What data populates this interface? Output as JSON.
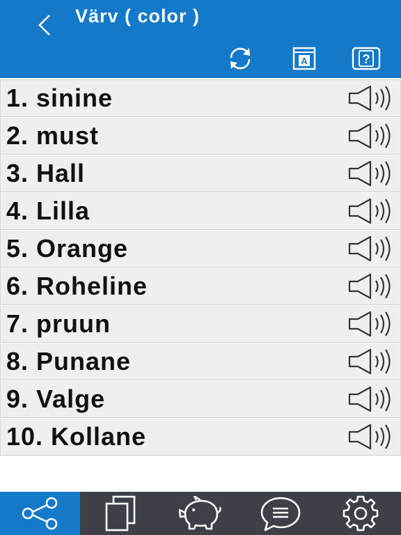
{
  "header": {
    "title": "Värv ( color )",
    "back_icon": "chevron-left-icon",
    "actions": [
      {
        "name": "refresh-icon"
      },
      {
        "name": "dictionary-icon",
        "glyph": "A"
      },
      {
        "name": "help-icon",
        "glyph": "?"
      }
    ]
  },
  "words": [
    {
      "label": "1. sinine"
    },
    {
      "label": "2. must"
    },
    {
      "label": "3. Hall"
    },
    {
      "label": "4. Lilla"
    },
    {
      "label": "5. Orange"
    },
    {
      "label": "6. Roheline"
    },
    {
      "label": "7. pruun"
    },
    {
      "label": "8. Punane"
    },
    {
      "label": "9. Valge"
    },
    {
      "label": "10. Kollane"
    }
  ],
  "tabbar": {
    "tabs": [
      {
        "name": "share-icon",
        "active": true
      },
      {
        "name": "copy-icon",
        "active": false
      },
      {
        "name": "piggy-bank-icon",
        "active": false
      },
      {
        "name": "chat-icon",
        "active": false
      },
      {
        "name": "gear-icon",
        "active": false
      }
    ]
  },
  "colors": {
    "accent": "#1479c9",
    "tabbar": "#3d4147",
    "row_bg": "#efefef"
  }
}
